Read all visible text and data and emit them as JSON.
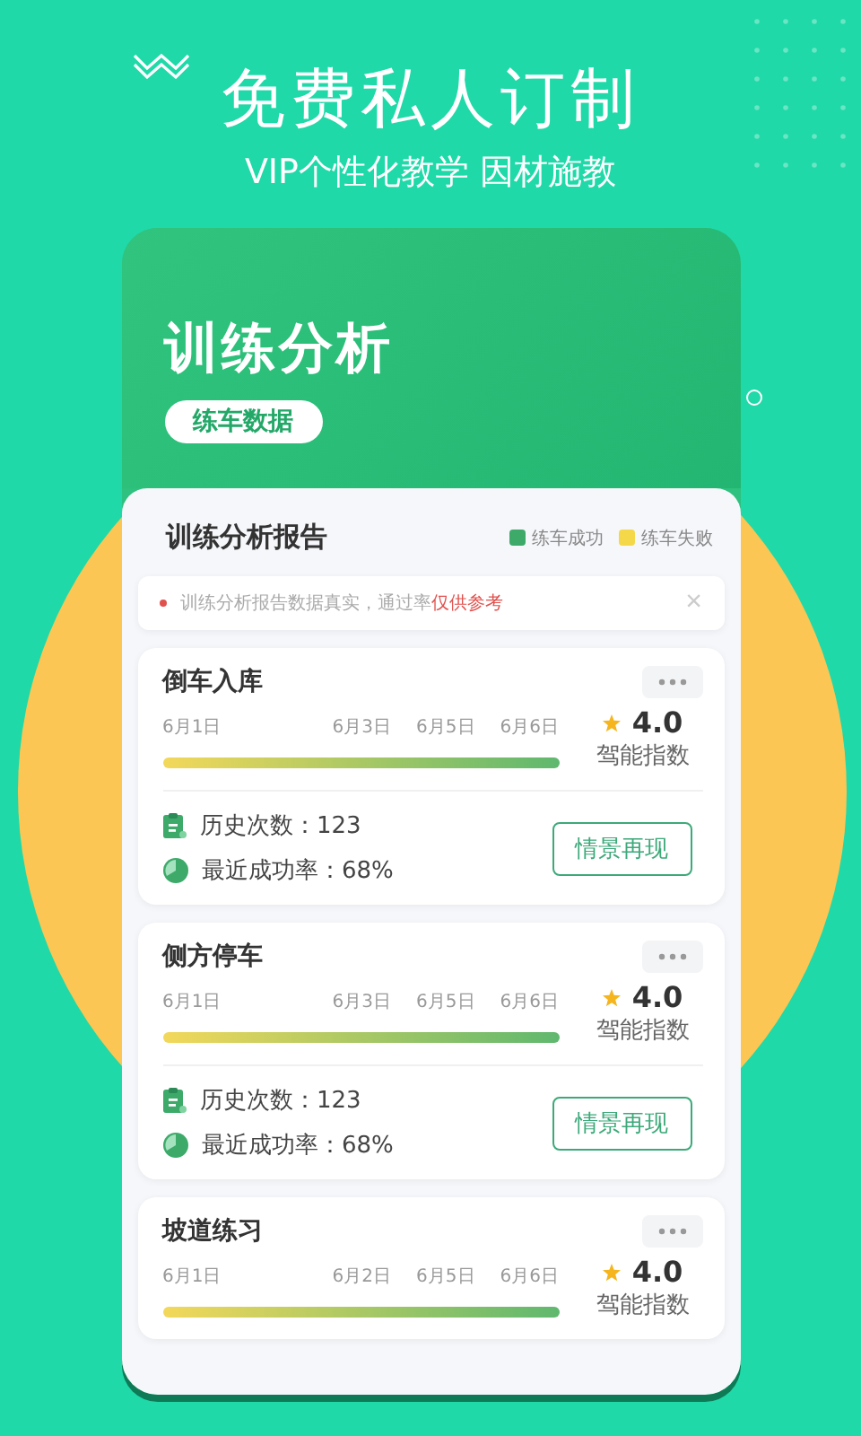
{
  "promo": {
    "headline": "免费私人订制",
    "subtitle": "VIP个性化教学 因材施教"
  },
  "screen": {
    "title": "训练分析",
    "tag": "练车数据",
    "report": {
      "title": "训练分析报告",
      "legend": [
        {
          "label": "练车成功",
          "color": "#3daa6a"
        },
        {
          "label": "练车失败",
          "color": "#f5d84a"
        }
      ],
      "notice": {
        "text": "训练分析报告数据真实，通过率",
        "highlight": "仅供参考",
        "close": "×"
      }
    },
    "drills": [
      {
        "name": "倒车入库",
        "dates": [
          "6月1日",
          "6月3日",
          "6月5日",
          "6月6日"
        ],
        "score": "4.0",
        "score_label": "驾能指数",
        "history": "历史次数：123",
        "rate": "最近成功率：68%",
        "button": "情景再现"
      },
      {
        "name": "侧方停车",
        "dates": [
          "6月1日",
          "6月3日",
          "6月5日",
          "6月6日"
        ],
        "score": "4.0",
        "score_label": "驾能指数",
        "history": "历史次数：123",
        "rate": "最近成功率：68%",
        "button": "情景再现"
      },
      {
        "name": "坡道练习",
        "dates": [
          "6月1日",
          "6月2日",
          "6月5日",
          "6月6日"
        ],
        "score": "4.0",
        "score_label": "驾能指数"
      }
    ]
  }
}
